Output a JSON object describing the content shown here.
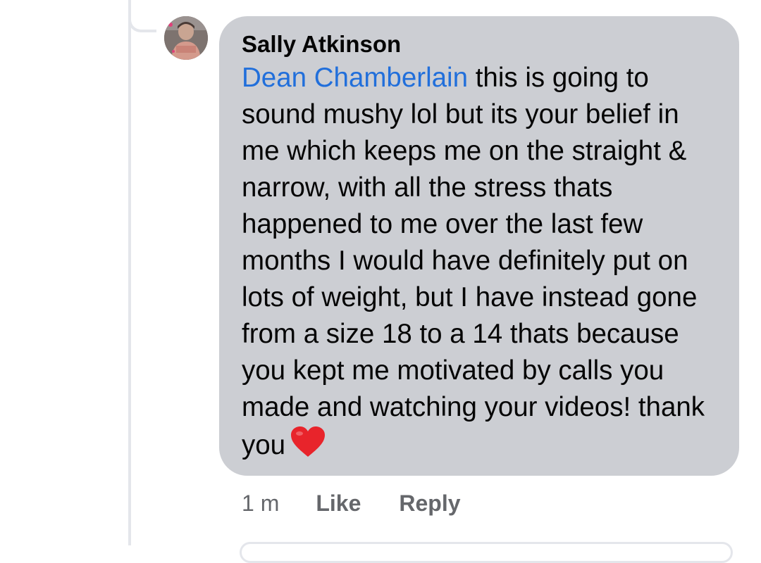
{
  "comment": {
    "author": "Sally Atkinson",
    "mention": "Dean Chamberlain",
    "text": " this is going to sound mushy lol but its your belief in me which keeps me on the straight & narrow, with all the stress thats happened to me over the last few months I would have definitely put on lots of weight, but I have instead gone from a size 18 to a 14 thats because you kept me motivated by calls you made and watching your videos! thank you",
    "emoji": "heart-icon",
    "timestamp": "1 m",
    "like_label": "Like",
    "reply_label": "Reply"
  },
  "colors": {
    "bubble": "#ccced3",
    "mention": "#216fdb",
    "meta_text": "#65676b",
    "heart": "#e8242b"
  }
}
